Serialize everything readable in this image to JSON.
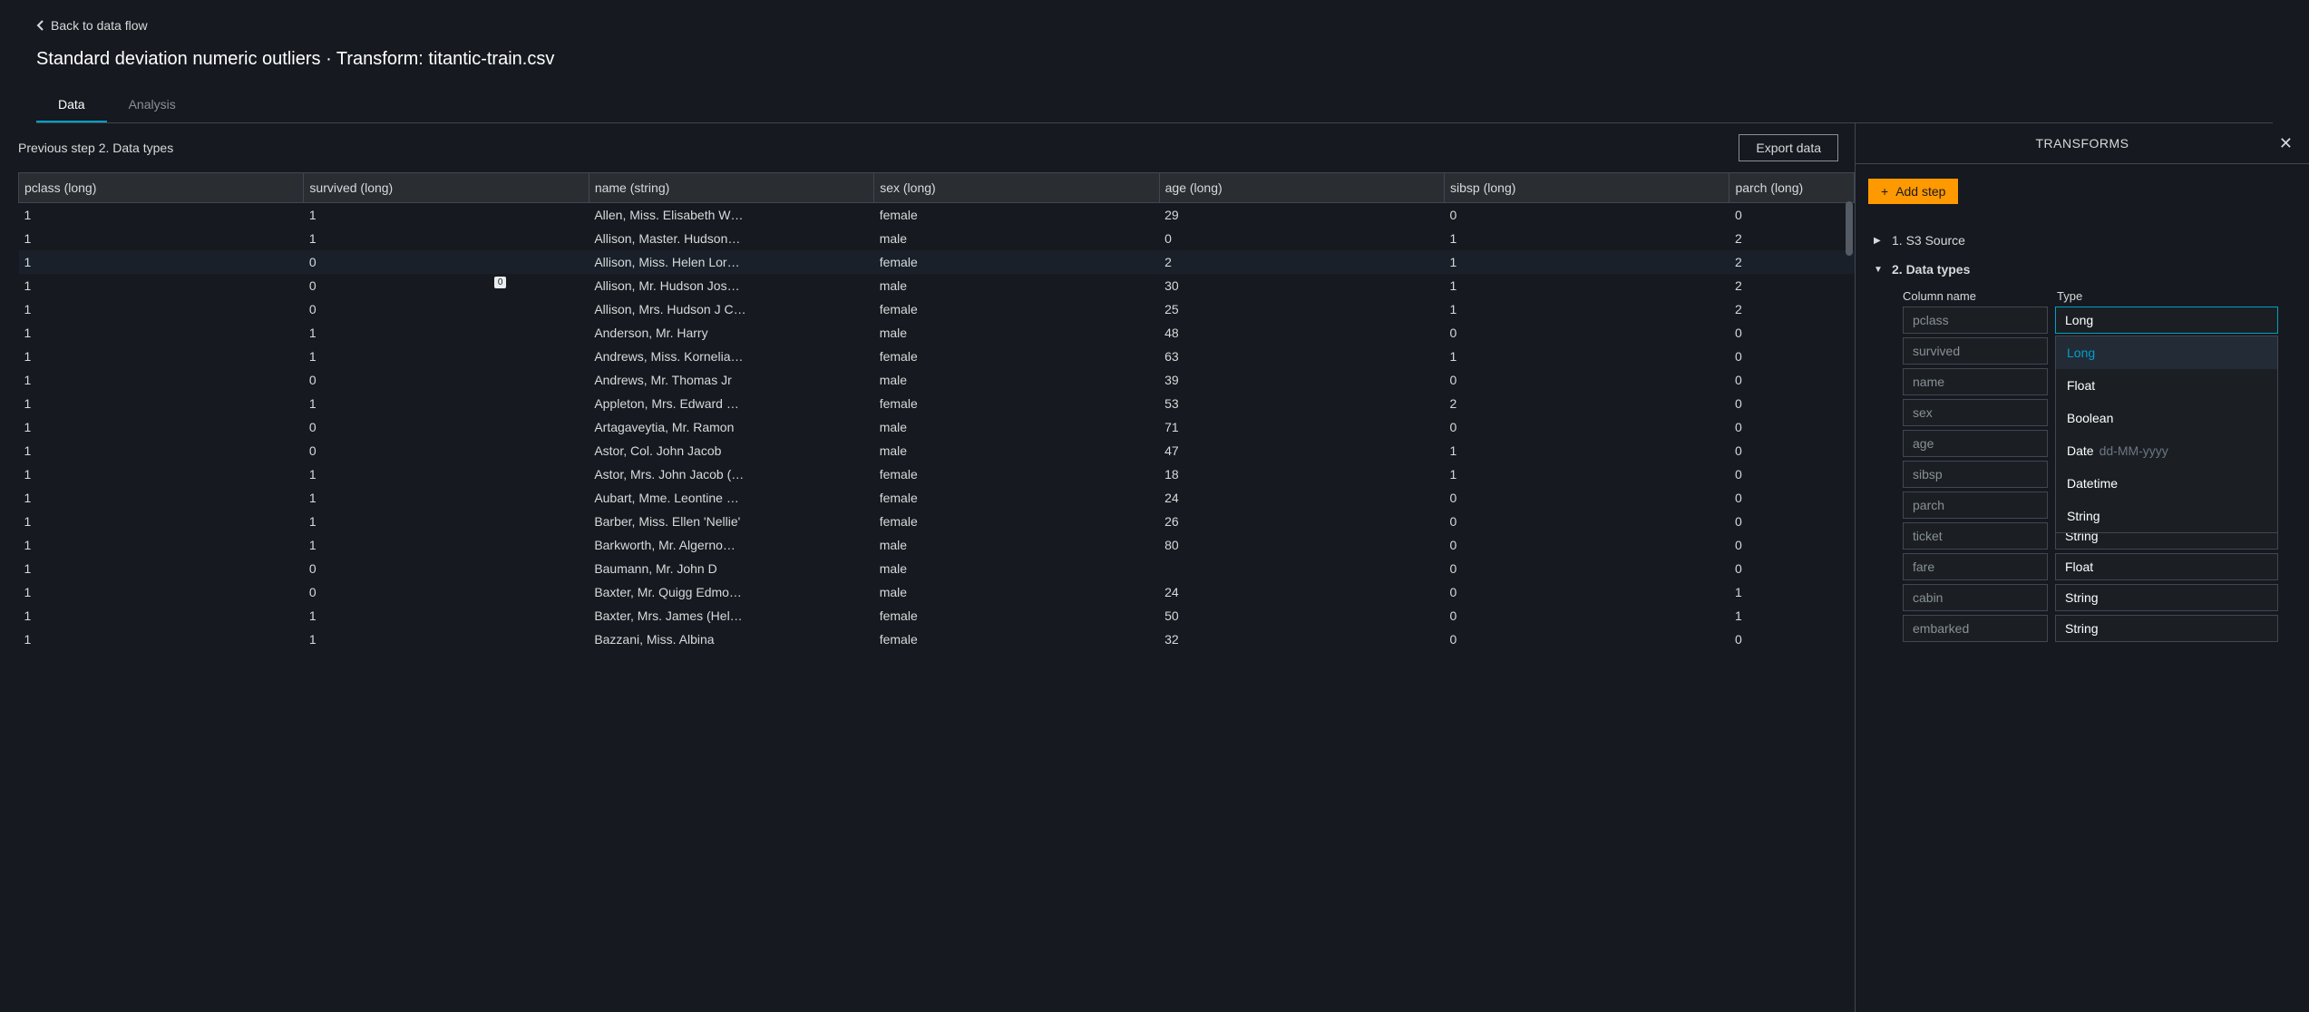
{
  "back_link": "Back to data flow",
  "page_title": "Standard deviation numeric outliers · Transform: titantic-train.csv",
  "tabs": [
    "Data",
    "Analysis"
  ],
  "active_tab": 0,
  "previous_step": "Previous step 2. Data types",
  "export_button": "Export data",
  "columns": [
    {
      "key": "pclass",
      "label": "pclass (long)"
    },
    {
      "key": "survived",
      "label": "survived (long)"
    },
    {
      "key": "name",
      "label": "name (string)"
    },
    {
      "key": "sex",
      "label": "sex (long)"
    },
    {
      "key": "age",
      "label": "age (long)"
    },
    {
      "key": "sibsp",
      "label": "sibsp (long)"
    },
    {
      "key": "parch",
      "label": "parch (long)"
    }
  ],
  "rows": [
    {
      "pclass": "1",
      "survived": "1",
      "name": "Allen, Miss. Elisabeth W…",
      "sex": "female",
      "age": "29",
      "sibsp": "0",
      "parch": "0"
    },
    {
      "pclass": "1",
      "survived": "1",
      "name": "Allison, Master. Hudson…",
      "sex": "male",
      "age": "0",
      "sibsp": "1",
      "parch": "2"
    },
    {
      "pclass": "1",
      "survived": "0",
      "name": "Allison, Miss. Helen Lor…",
      "sex": "female",
      "age": "2",
      "sibsp": "1",
      "parch": "2"
    },
    {
      "pclass": "1",
      "survived": "0",
      "name": "Allison, Mr. Hudson Jos…",
      "sex": "male",
      "age": "30",
      "sibsp": "1",
      "parch": "2",
      "tooltip": "0"
    },
    {
      "pclass": "1",
      "survived": "0",
      "name": "Allison, Mrs. Hudson J C…",
      "sex": "female",
      "age": "25",
      "sibsp": "1",
      "parch": "2"
    },
    {
      "pclass": "1",
      "survived": "1",
      "name": "Anderson, Mr. Harry",
      "sex": "male",
      "age": "48",
      "sibsp": "0",
      "parch": "0"
    },
    {
      "pclass": "1",
      "survived": "1",
      "name": "Andrews, Miss. Kornelia…",
      "sex": "female",
      "age": "63",
      "sibsp": "1",
      "parch": "0"
    },
    {
      "pclass": "1",
      "survived": "0",
      "name": "Andrews, Mr. Thomas Jr",
      "sex": "male",
      "age": "39",
      "sibsp": "0",
      "parch": "0"
    },
    {
      "pclass": "1",
      "survived": "1",
      "name": "Appleton, Mrs. Edward …",
      "sex": "female",
      "age": "53",
      "sibsp": "2",
      "parch": "0"
    },
    {
      "pclass": "1",
      "survived": "0",
      "name": "Artagaveytia, Mr. Ramon",
      "sex": "male",
      "age": "71",
      "sibsp": "0",
      "parch": "0"
    },
    {
      "pclass": "1",
      "survived": "0",
      "name": "Astor, Col. John Jacob",
      "sex": "male",
      "age": "47",
      "sibsp": "1",
      "parch": "0"
    },
    {
      "pclass": "1",
      "survived": "1",
      "name": "Astor, Mrs. John Jacob (…",
      "sex": "female",
      "age": "18",
      "sibsp": "1",
      "parch": "0"
    },
    {
      "pclass": "1",
      "survived": "1",
      "name": "Aubart, Mme. Leontine …",
      "sex": "female",
      "age": "24",
      "sibsp": "0",
      "parch": "0"
    },
    {
      "pclass": "1",
      "survived": "1",
      "name": "Barber, Miss. Ellen 'Nellie'",
      "sex": "female",
      "age": "26",
      "sibsp": "0",
      "parch": "0"
    },
    {
      "pclass": "1",
      "survived": "1",
      "name": "Barkworth, Mr. Algerno…",
      "sex": "male",
      "age": "80",
      "sibsp": "0",
      "parch": "0"
    },
    {
      "pclass": "1",
      "survived": "0",
      "name": "Baumann, Mr. John D",
      "sex": "male",
      "age": "",
      "sibsp": "0",
      "parch": "0"
    },
    {
      "pclass": "1",
      "survived": "0",
      "name": "Baxter, Mr. Quigg Edmo…",
      "sex": "male",
      "age": "24",
      "sibsp": "0",
      "parch": "1"
    },
    {
      "pclass": "1",
      "survived": "1",
      "name": "Baxter, Mrs. James (Hel…",
      "sex": "female",
      "age": "50",
      "sibsp": "0",
      "parch": "1"
    },
    {
      "pclass": "1",
      "survived": "1",
      "name": "Bazzani, Miss. Albina",
      "sex": "female",
      "age": "32",
      "sibsp": "0",
      "parch": "0"
    }
  ],
  "highlight_row": 2,
  "right_panel": {
    "title": "TRANSFORMS",
    "add_step": "Add step",
    "steps": [
      {
        "label": "1. S3 Source",
        "expanded": false
      },
      {
        "label": "2. Data types",
        "expanded": true
      }
    ],
    "column_header": "Column name",
    "type_header": "Type",
    "type_rows": [
      {
        "name": "pclass",
        "type": "Long",
        "active": true
      },
      {
        "name": "survived",
        "type": ""
      },
      {
        "name": "name",
        "type": ""
      },
      {
        "name": "sex",
        "type": ""
      },
      {
        "name": "age",
        "type": ""
      },
      {
        "name": "sibsp",
        "type": ""
      },
      {
        "name": "parch",
        "type": ""
      },
      {
        "name": "ticket",
        "type": "String"
      },
      {
        "name": "fare",
        "type": "Float"
      },
      {
        "name": "cabin",
        "type": "String"
      },
      {
        "name": "embarked",
        "type": "String"
      }
    ],
    "dropdown": {
      "options": [
        "Long",
        "Float",
        "Boolean",
        "Date",
        "Datetime",
        "String"
      ],
      "date_hint": "dd-MM-yyyy",
      "selected": "Long"
    }
  }
}
